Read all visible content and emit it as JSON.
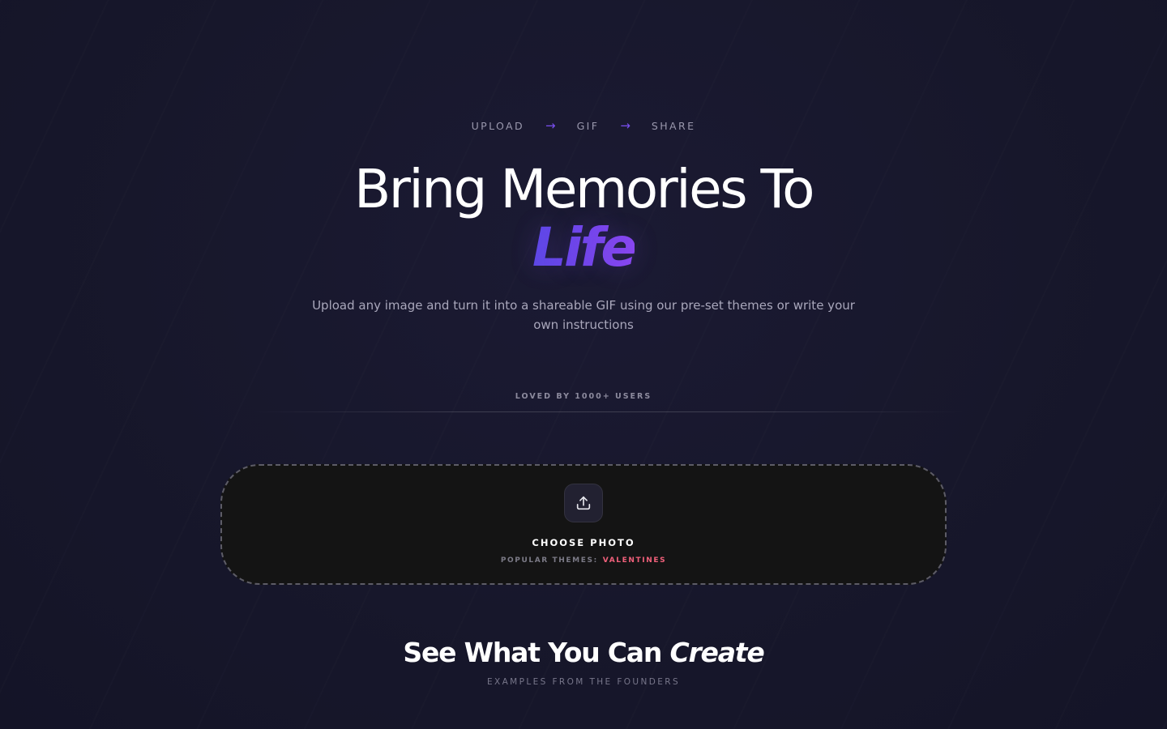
{
  "steps": {
    "upload": "UPLOAD",
    "gif": "GIF",
    "share": "SHARE",
    "arrow": "→"
  },
  "hero": {
    "title": "Bring Memories To",
    "accent": "Life",
    "subtitle": "Upload any image and turn it into a shareable GIF using our pre-set themes or write your own instructions"
  },
  "social_proof": {
    "text": "LOVED BY 1000+ USERS"
  },
  "upload": {
    "icon": "upload-icon",
    "choose_label": "CHOOSE PHOTO",
    "themes_label": "POPULAR THEMES:",
    "themes": [
      "VALENTINES"
    ]
  },
  "examples": {
    "title": "See What You Can",
    "title_accent": "Create",
    "subtitle": "EXAMPLES FROM THE FOUNDERS"
  },
  "colors": {
    "background": "#17172a",
    "accent_purple": "#7a4ff0",
    "theme_pink": "#f0607a",
    "dropzone_bg": "#141414"
  }
}
